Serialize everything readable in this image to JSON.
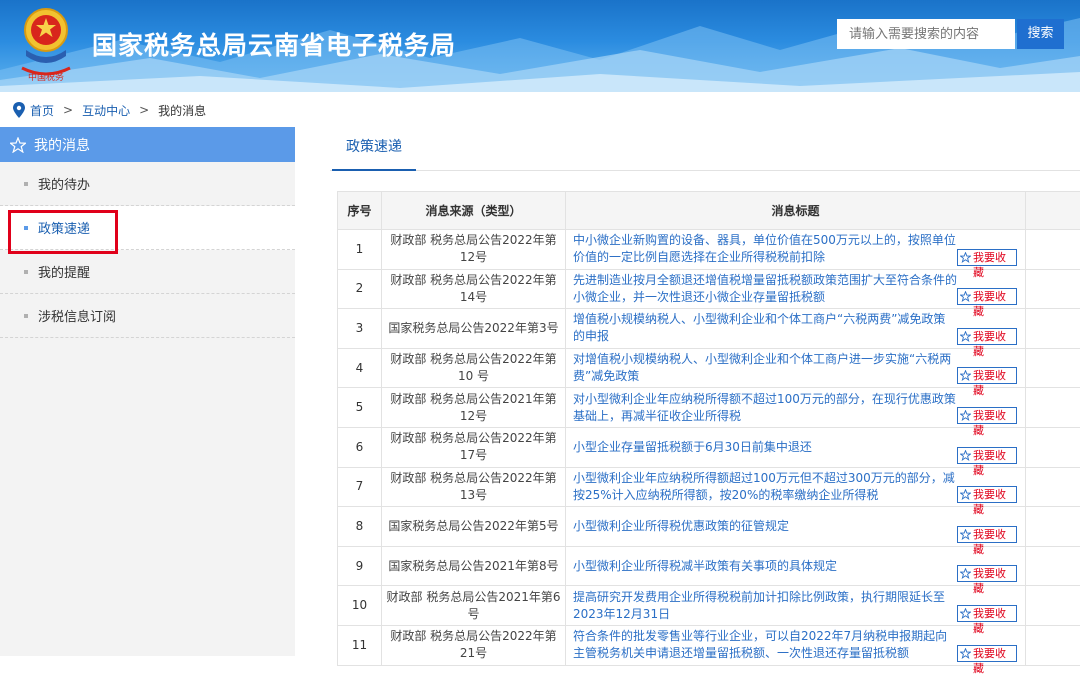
{
  "header": {
    "site_title": "国家税务总局云南省电子税务局",
    "search_placeholder": "请输入需要搜索的内容",
    "search_button": "搜索"
  },
  "breadcrumb": {
    "items": [
      "首页",
      "互动中心",
      "我的消息"
    ],
    "separator": ">"
  },
  "sidebar": {
    "title": "我的消息",
    "items": [
      {
        "label": "我的待办",
        "active": false
      },
      {
        "label": "政策速递",
        "active": true
      },
      {
        "label": "我的提醒",
        "active": false
      },
      {
        "label": "涉税信息订阅",
        "active": false
      }
    ]
  },
  "tab": {
    "label": "政策速递"
  },
  "table": {
    "headers": [
      "序号",
      "消息来源（类型）",
      "消息标题"
    ],
    "fav_label": "我要收藏",
    "rows": [
      {
        "no": "1",
        "source": "财政部 税务总局公告2022年第12号",
        "title": "中小微企业新购置的设备、器具，单位价值在500万元以上的，按照单位价值的一定比例自愿选择在企业所得税税前扣除"
      },
      {
        "no": "2",
        "source": "财政部 税务总局公告2022年第14号",
        "title": "先进制造业按月全额退还增值税增量留抵税额政策范围扩大至符合条件的小微企业，并一次性退还小微企业存量留抵税额"
      },
      {
        "no": "3",
        "source": "国家税务总局公告2022年第3号",
        "title": "增值税小规模纳税人、小型微利企业和个体工商户“六税两费”减免政策的申报"
      },
      {
        "no": "4",
        "source": "财政部 税务总局公告2022年第 10 号",
        "title": "对增值税小规模纳税人、小型微利企业和个体工商户进一步实施“六税两费”减免政策"
      },
      {
        "no": "5",
        "source": "财政部 税务总局公告2021年第12号",
        "title": "对小型微利企业年应纳税所得额不超过100万元的部分，在现行优惠政策基础上，再减半征收企业所得税"
      },
      {
        "no": "6",
        "source": "财政部 税务总局公告2022年第17号",
        "title": "小型企业存量留抵税额于6月30日前集中退还"
      },
      {
        "no": "7",
        "source": "财政部 税务总局公告2022年第13号",
        "title": "小型微利企业年应纳税所得额超过100万元但不超过300万元的部分，减按25%计入应纳税所得额，按20%的税率缴纳企业所得税"
      },
      {
        "no": "8",
        "source": "国家税务总局公告2022年第5号",
        "title": "小型微利企业所得税优惠政策的征管规定"
      },
      {
        "no": "9",
        "source": "国家税务总局公告2021年第8号",
        "title": "小型微利企业所得税减半政策有关事项的具体规定"
      },
      {
        "no": "10",
        "source": "财政部 税务总局公告2021年第6号",
        "title": "提高研究开发费用企业所得税税前加计扣除比例政策，执行期限延长至2023年12月31日"
      },
      {
        "no": "11",
        "source": "财政部 税务总局公告2022年第21号",
        "title": "符合条件的批发零售业等行业企业，可以自2022年7月纳税申报期起向主管税务机关申请退还增量留抵税额、一次性退还存量留抵税额"
      }
    ]
  },
  "colors": {
    "banner": "#2b8ce0",
    "sidebar_head": "#5b9ae8",
    "link": "#2b6fc6",
    "highlight_box": "#e0001a"
  }
}
